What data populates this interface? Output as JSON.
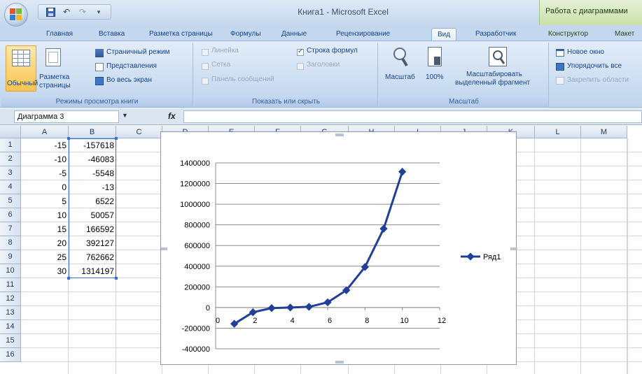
{
  "title_bar": {
    "window_title": "Книга1 - Microsoft Excel",
    "context_tool_title": "Работа с диаграммами"
  },
  "tabs": [
    {
      "label": "Главная",
      "active": false
    },
    {
      "label": "Вставка",
      "active": false
    },
    {
      "label": "Разметка страницы",
      "active": false
    },
    {
      "label": "Формулы",
      "active": false
    },
    {
      "label": "Данные",
      "active": false
    },
    {
      "label": "Рецензирование",
      "active": false
    },
    {
      "label": "Вид",
      "active": true
    },
    {
      "label": "Разработчик",
      "active": false
    },
    {
      "label": "Конструктор",
      "active": false
    },
    {
      "label": "Макет",
      "active": false
    }
  ],
  "ribbon": {
    "views_group": {
      "label": "Режимы просмотра книги",
      "normal": "Обычный",
      "page_layout_line1": "Разметка",
      "page_layout_line2": "страницы",
      "page_break": "Страничный режим",
      "custom_views": "Представления",
      "full_screen": "Во весь экран"
    },
    "show_group": {
      "label": "Показать или скрыть",
      "ruler": "Линейка",
      "gridlines": "Сетка",
      "message_bar": "Панель сообщений",
      "formula_bar": "Строка формул",
      "headings": "Заголовки"
    },
    "zoom_group": {
      "label": "Масштаб",
      "zoom": "Масштаб",
      "zoom_100": "100%",
      "zoom_sel_line1": "Масштабировать",
      "zoom_sel_line2": "выделенный фрагмент"
    },
    "window_group": {
      "new_window": "Новое окно",
      "arrange_all": "Упорядочить все",
      "freeze_panes": "Закрепить области"
    }
  },
  "formula_bar": {
    "name_box": "Диаграмма 3",
    "fx_label": "fx",
    "formula": ""
  },
  "sheet": {
    "columns": [
      "A",
      "B",
      "C",
      "D",
      "E",
      "F",
      "G",
      "H",
      "I",
      "J",
      "K",
      "L",
      "M"
    ],
    "rows": [
      "1",
      "2",
      "3",
      "4",
      "5",
      "6",
      "7",
      "8",
      "9",
      "10",
      "11",
      "12",
      "13",
      "14",
      "15",
      "16"
    ],
    "col_a": [
      "-15",
      "-10",
      "-5",
      "0",
      "5",
      "10",
      "15",
      "20",
      "25",
      "30"
    ],
    "col_b": [
      "-157618",
      "-46083",
      "-5548",
      "-13",
      "6522",
      "50057",
      "166592",
      "392127",
      "762662",
      "1314197"
    ]
  },
  "chart_data": {
    "type": "line",
    "x": [
      1,
      2,
      3,
      4,
      5,
      6,
      7,
      8,
      9,
      10
    ],
    "series": [
      {
        "name": "Ряд1",
        "values": [
          -157618,
          -46083,
          -5548,
          -13,
          6522,
          50057,
          166592,
          392127,
          762662,
          1314197
        ]
      }
    ],
    "x_ticks": [
      "0",
      "2",
      "4",
      "6",
      "8",
      "10",
      "12"
    ],
    "y_ticks": [
      "1400000",
      "1200000",
      "1000000",
      "800000",
      "600000",
      "400000",
      "200000",
      "0",
      "-200000",
      "-400000"
    ],
    "xlim": [
      0,
      12
    ],
    "ylim": [
      -400000,
      1400000
    ],
    "grid": "horizontal",
    "legend_position": "right",
    "color": "#1f3f99"
  }
}
